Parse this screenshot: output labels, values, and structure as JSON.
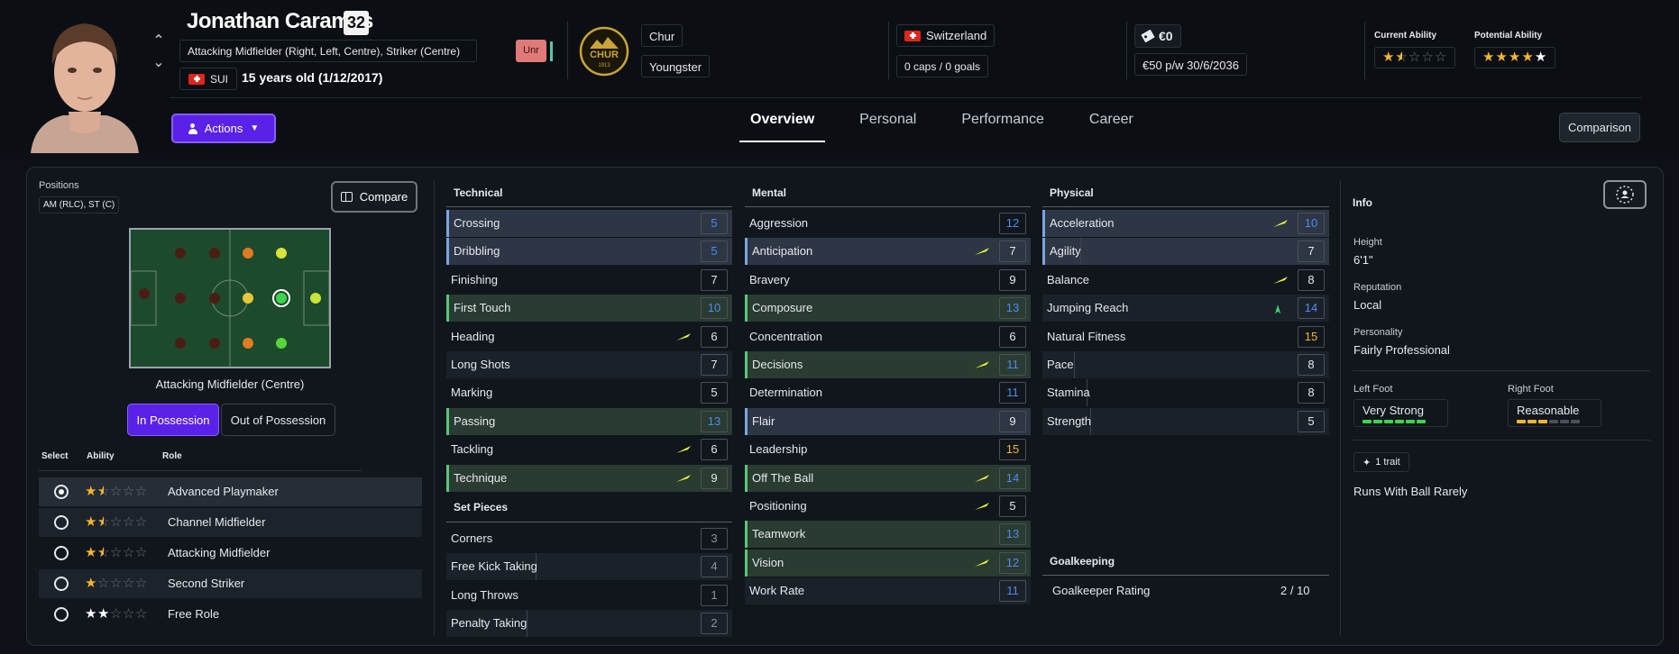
{
  "player": {
    "name": "Jonathan Caramés",
    "number": "32",
    "positions": "Attacking Midfielder (Right, Left, Centre), Striker (Centre)",
    "nationality_code": "SUI",
    "age": "15 years old (1/12/2017)",
    "rating_badge": "Unr",
    "club": "Chur",
    "squad_status": "Youngster",
    "national_team": "Switzerland",
    "caps": "0 caps / 0 goals",
    "value": "€0",
    "contract": "€50 p/w 30/6/2036",
    "current_ability_label": "Current Ability",
    "current_ability_stars": 1.5,
    "potential_ability_label": "Potential Ability",
    "potential_ability_stars": 4.5
  },
  "crest": {
    "name": "CHUR",
    "year": "1913"
  },
  "actions_label": "Actions",
  "tabs": [
    {
      "label": "Overview",
      "active": true
    },
    {
      "label": "Personal",
      "active": false
    },
    {
      "label": "Performance",
      "active": false
    },
    {
      "label": "Career",
      "active": false
    }
  ],
  "comparison_label": "Comparison",
  "left": {
    "positions_label": "Positions",
    "positions_value": "AM (RLC), ST (C)",
    "compare_label": "Compare",
    "pitch_caption": "Attacking Midfielder (Centre)",
    "in_possession": "In Possession",
    "out_possession": "Out of Possession",
    "role_headers": {
      "select": "Select",
      "ability": "Ability",
      "role": "Role"
    },
    "roles": [
      {
        "name": "Advanced Playmaker",
        "stars": 1.5,
        "selected": true
      },
      {
        "name": "Channel Midfielder",
        "stars": 1.5,
        "selected": false
      },
      {
        "name": "Attacking Midfielder",
        "stars": 1.5,
        "selected": false
      },
      {
        "name": "Second Striker",
        "stars": 1,
        "selected": false
      },
      {
        "name": "Free Role",
        "stars": 2,
        "selected": false
      }
    ]
  },
  "technical": {
    "title": "Technical",
    "rows": [
      {
        "name": "Crossing",
        "value": "5"
      },
      {
        "name": "Dribbling",
        "value": "5"
      },
      {
        "name": "Finishing",
        "value": "7"
      },
      {
        "name": "First Touch",
        "value": "10"
      },
      {
        "name": "Heading",
        "value": "6"
      },
      {
        "name": "Long Shots",
        "value": "7"
      },
      {
        "name": "Marking",
        "value": "5"
      },
      {
        "name": "Passing",
        "value": "13"
      },
      {
        "name": "Tackling",
        "value": "6"
      },
      {
        "name": "Technique",
        "value": "9"
      }
    ]
  },
  "set_pieces": {
    "title": "Set Pieces",
    "rows": [
      {
        "name": "Corners",
        "value": "3"
      },
      {
        "name": "Free Kick Taking",
        "value": "4"
      },
      {
        "name": "Long Throws",
        "value": "1"
      },
      {
        "name": "Penalty Taking",
        "value": "2"
      }
    ]
  },
  "mental": {
    "title": "Mental",
    "rows": [
      {
        "name": "Aggression",
        "value": "12"
      },
      {
        "name": "Anticipation",
        "value": "7"
      },
      {
        "name": "Bravery",
        "value": "9"
      },
      {
        "name": "Composure",
        "value": "13"
      },
      {
        "name": "Concentration",
        "value": "6"
      },
      {
        "name": "Decisions",
        "value": "11"
      },
      {
        "name": "Determination",
        "value": "11"
      },
      {
        "name": "Flair",
        "value": "9"
      },
      {
        "name": "Leadership",
        "value": "15"
      },
      {
        "name": "Off The Ball",
        "value": "14"
      },
      {
        "name": "Positioning",
        "value": "5"
      },
      {
        "name": "Teamwork",
        "value": "13"
      },
      {
        "name": "Vision",
        "value": "12"
      },
      {
        "name": "Work Rate",
        "value": "11"
      }
    ]
  },
  "physical": {
    "title": "Physical",
    "rows": [
      {
        "name": "Acceleration",
        "value": "10"
      },
      {
        "name": "Agility",
        "value": "7"
      },
      {
        "name": "Balance",
        "value": "8"
      },
      {
        "name": "Jumping Reach",
        "value": "14"
      },
      {
        "name": "Natural Fitness",
        "value": "15"
      },
      {
        "name": "Pace",
        "value": "8"
      },
      {
        "name": "Stamina",
        "value": "8"
      },
      {
        "name": "Strength",
        "value": "5"
      }
    ]
  },
  "goalkeeping": {
    "title": "Goalkeeping",
    "label": "Goalkeeper Rating",
    "value": "2 / 10"
  },
  "info": {
    "title": "Info",
    "height_label": "Height",
    "height": "6'1\"",
    "reputation_label": "Reputation",
    "reputation": "Local",
    "personality_label": "Personality",
    "personality": "Fairly Professional",
    "left_foot_label": "Left Foot",
    "left_foot": "Very Strong",
    "left_foot_level": 6,
    "right_foot_label": "Right Foot",
    "right_foot": "Reasonable",
    "right_foot_level": 3,
    "trait_count": "1 trait",
    "trait": "Runs With Ball Rarely"
  },
  "colors": {
    "accent": "#5a22e8",
    "value_blue": "#4d8cf0",
    "value_gold": "#f5b52b",
    "trend_yellow": "#e8f53a",
    "trend_green": "#3fd46c",
    "highlight_green": "#2a3b31",
    "highlight_blue": "#2d3645"
  }
}
